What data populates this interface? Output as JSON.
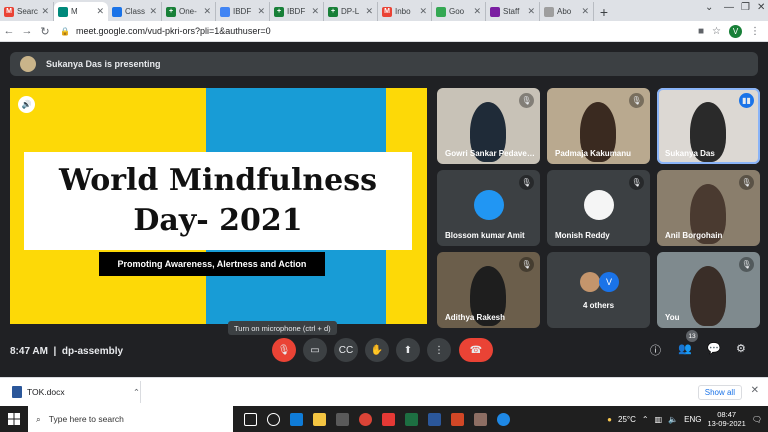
{
  "browser": {
    "tabs": [
      {
        "label": "Searc",
        "color": "#ea4335",
        "glyph": "M"
      },
      {
        "label": "M",
        "color": "#00897b",
        "glyph": "",
        "active": true
      },
      {
        "label": "Class",
        "color": "#1a73e8",
        "glyph": ""
      },
      {
        "label": "One-",
        "color": "#188038",
        "glyph": "+"
      },
      {
        "label": "IBDF",
        "color": "#4285f4",
        "glyph": ""
      },
      {
        "label": "IBDF",
        "color": "#188038",
        "glyph": "+"
      },
      {
        "label": "DP-L",
        "color": "#188038",
        "glyph": "+"
      },
      {
        "label": "Inbo",
        "color": "#ea4335",
        "glyph": "M"
      },
      {
        "label": "Goo",
        "color": "#34a853",
        "glyph": ""
      },
      {
        "label": "Staff",
        "color": "#7b1fa2",
        "glyph": ""
      },
      {
        "label": "Abo",
        "color": "#9e9e9e",
        "glyph": ""
      }
    ],
    "new_tab": "+",
    "url": "meet.google.com/vud-pkri-ors?pli=1&authuser=0",
    "profile_initial": "V"
  },
  "meet": {
    "presenting_banner": "Sukanya Das is presenting",
    "slide": {
      "title_line1": "World Mindfulness",
      "title_line2": "Day- 2021",
      "subtitle": "Promoting Awareness, Alertness and Action"
    },
    "participants": [
      {
        "name": "Gowri Sankar Pedaveedu",
        "muted": true
      },
      {
        "name": "Padmaja Kakumanu",
        "muted": true
      },
      {
        "name": "Sukanya Das",
        "muted": false,
        "speaking": true
      },
      {
        "name": "Blossom kumar Amit",
        "muted": true
      },
      {
        "name": "Monish Reddy",
        "muted": true
      },
      {
        "name": "Anil Borgohain",
        "muted": true
      },
      {
        "name": "Adithya Rakesh",
        "muted": true
      },
      {
        "name": "4 others",
        "muted": false,
        "initial": "V"
      },
      {
        "name": "You",
        "muted": true
      }
    ],
    "time": "8:47 AM",
    "meeting_name": "dp-assembly",
    "tooltip": "Turn on microphone (ctrl + d)",
    "people_count": "13"
  },
  "downloads": {
    "file": "TOK.docx",
    "show_all": "Show all"
  },
  "taskbar": {
    "search_placeholder": "Type here to search",
    "weather": "25°C",
    "language": "ENG",
    "time": "08:47",
    "date": "13-09-2021"
  }
}
